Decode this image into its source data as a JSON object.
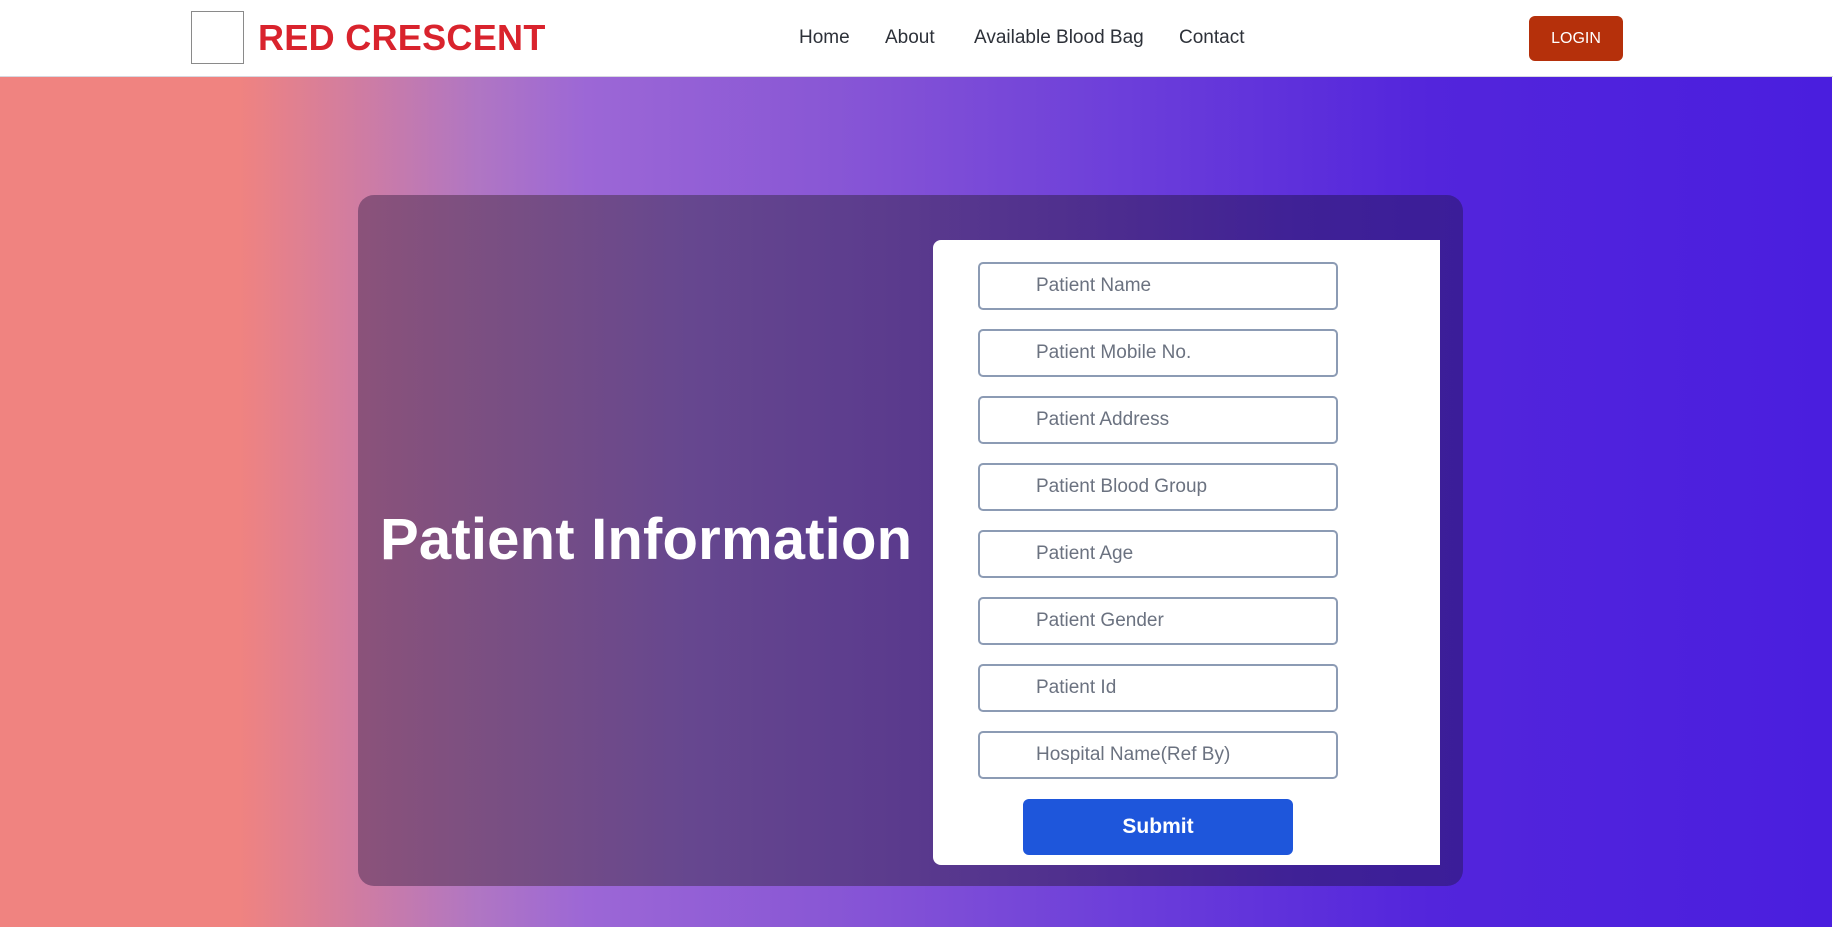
{
  "header": {
    "logo_icon": "crescent-icon",
    "brand": "RED CRESCENT",
    "nav": [
      {
        "label": "Home"
      },
      {
        "label": "About"
      },
      {
        "label": "Available Blood Bag"
      },
      {
        "label": "Contact"
      }
    ],
    "login_label": "LOGIN"
  },
  "main": {
    "title": "Patient Information",
    "fields": [
      {
        "placeholder": "Patient Name"
      },
      {
        "placeholder": "Patient Mobile No."
      },
      {
        "placeholder": "Patient Address"
      },
      {
        "placeholder": "Patient Blood Group"
      },
      {
        "placeholder": "Patient Age"
      },
      {
        "placeholder": "Patient Gender"
      },
      {
        "placeholder": "Patient Id"
      },
      {
        "placeholder": "Hospital Name(Ref By)"
      }
    ],
    "submit_label": "Submit"
  },
  "colors": {
    "brand": "#d9232d",
    "login_button": "#b5300b",
    "submit_button": "#1e56db"
  }
}
